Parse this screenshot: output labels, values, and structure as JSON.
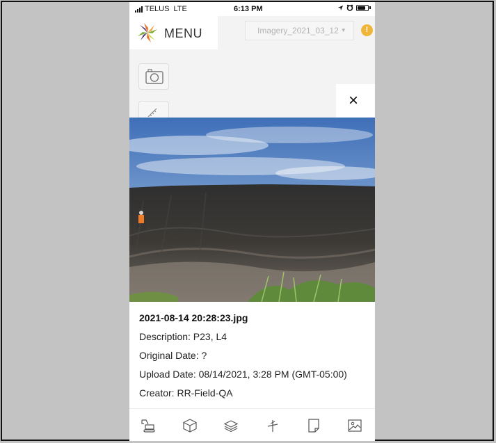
{
  "status_bar": {
    "carrier": "TELUS",
    "network": "LTE",
    "time": "6:13 PM"
  },
  "header": {
    "menu_label": "MENU",
    "imagery_select": "Imagery_2021_03_12",
    "alert_glyph": "!"
  },
  "side_tools": [
    "camera-icon",
    "ruler-icon"
  ],
  "modal": {
    "close_glyph": "×",
    "filename": "2021-08-14 20:28:23.jpg",
    "description": "Description: P23, L4",
    "original_date": "Original Date: ?",
    "upload_date": "Upload Date: 08/14/2021, 3:28 PM (GMT-05:00)",
    "creator": "Creator: RR-Field-QA"
  },
  "bottom_toolbar": [
    "excavator-icon",
    "cube-icon",
    "layers-icon",
    "measure-icon",
    "document-icon",
    "image-icon"
  ],
  "colors": {
    "background": "#c3c3c3",
    "alert": "#f0b63a",
    "logo_orange": "#e8742f",
    "logo_green": "#7fae3e",
    "logo_purple": "#5b3d7c"
  }
}
